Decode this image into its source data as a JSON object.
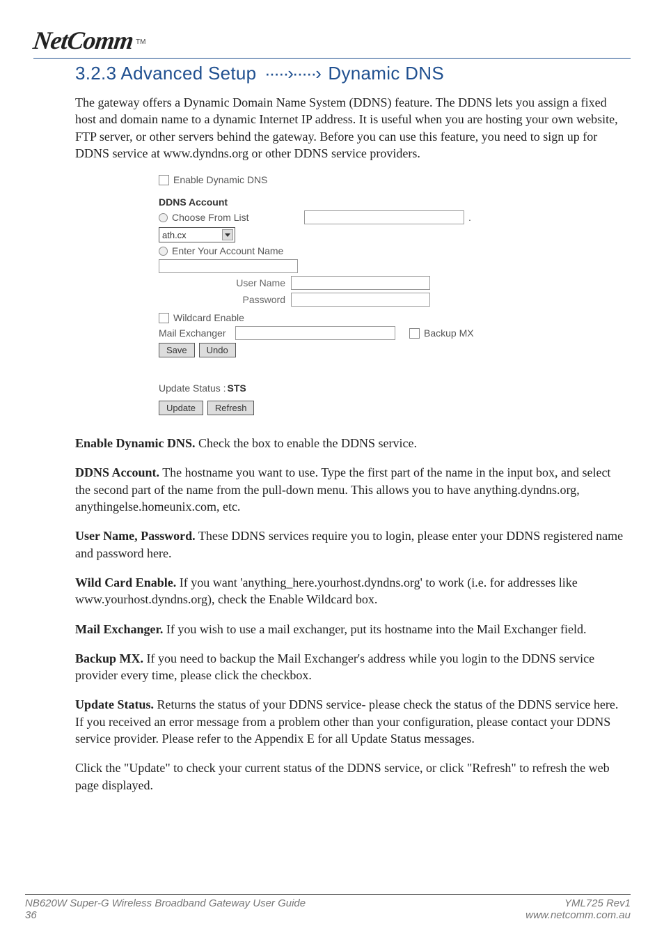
{
  "logo": {
    "brand": "NetComm",
    "tm": "TM"
  },
  "section": {
    "number": "3.2.3",
    "crumb1": "Advanced Setup",
    "crumb2": "Dynamic DNS"
  },
  "intro": "The gateway offers a Dynamic Domain Name System (DDNS) feature. The DDNS lets you assign a fixed host and domain name to a dynamic Internet IP address. It is useful when you are hosting your own website, FTP server, or other servers behind the gateway. Before you can use this feature, you need to sign up for DDNS service at www.dyndns.org or other DDNS service providers.",
  "shot": {
    "enable_label": "Enable Dynamic DNS",
    "account_header": "DDNS Account",
    "choose_label": "Choose From List",
    "select_value": "ath.cx",
    "dot": ".",
    "enter_label": "Enter Your Account Name",
    "user_label": "User Name",
    "pass_label": "Password",
    "wildcard_label": "Wildcard Enable",
    "mail_label": "Mail Exchanger",
    "backup_label": "Backup MX",
    "save_btn": "Save",
    "undo_btn": "Undo",
    "status_label": "Update Status :",
    "status_value": "STS",
    "update_btn": "Update",
    "refresh_btn": "Refresh"
  },
  "defs": {
    "d1b": "Enable Dynamic DNS.",
    "d1": " Check the box to enable the DDNS service.",
    "d2b": "DDNS Account.",
    "d2": " The hostname you want to use. Type the first part of the name in the input box, and select the second part of the name from the pull-down menu. This allows you to have anything.dyndns.org, anythingelse.homeunix.com, etc.",
    "d3b": "User Name, Password.",
    "d3": " These DDNS services require you to login, please enter your DDNS registered name and password here.",
    "d4b": "Wild Card Enable.",
    "d4": " If you want 'anything_here.yourhost.dyndns.org' to work (i.e. for addresses like www.yourhost.dyndns.org), check the Enable Wildcard box.",
    "d5b": "Mail Exchanger.",
    "d5": " If you wish to use a mail exchanger, put its hostname into the Mail Exchanger field.",
    "d6b": "Backup MX.",
    "d6": " If you need to backup the Mail Exchanger's address while you login to the DDNS service provider every time, please click the checkbox.",
    "d7b": "Update Status.",
    "d7": " Returns the status of your DDNS service- please check the status of the DDNS service here. If you received an error message from a problem other than your configuration, please contact your DDNS service provider. Please refer to the Appendix E for all Update Status messages.",
    "d8": "Click the \"Update\" to check your current status of the DDNS service, or click \"Refresh\" to refresh the web page displayed."
  },
  "footer": {
    "guide": "NB620W Super-G Wireless Broadband  Gateway User Guide",
    "pageno": "36",
    "rev": "YML725 Rev1",
    "url": "www.netcomm.com.au"
  }
}
